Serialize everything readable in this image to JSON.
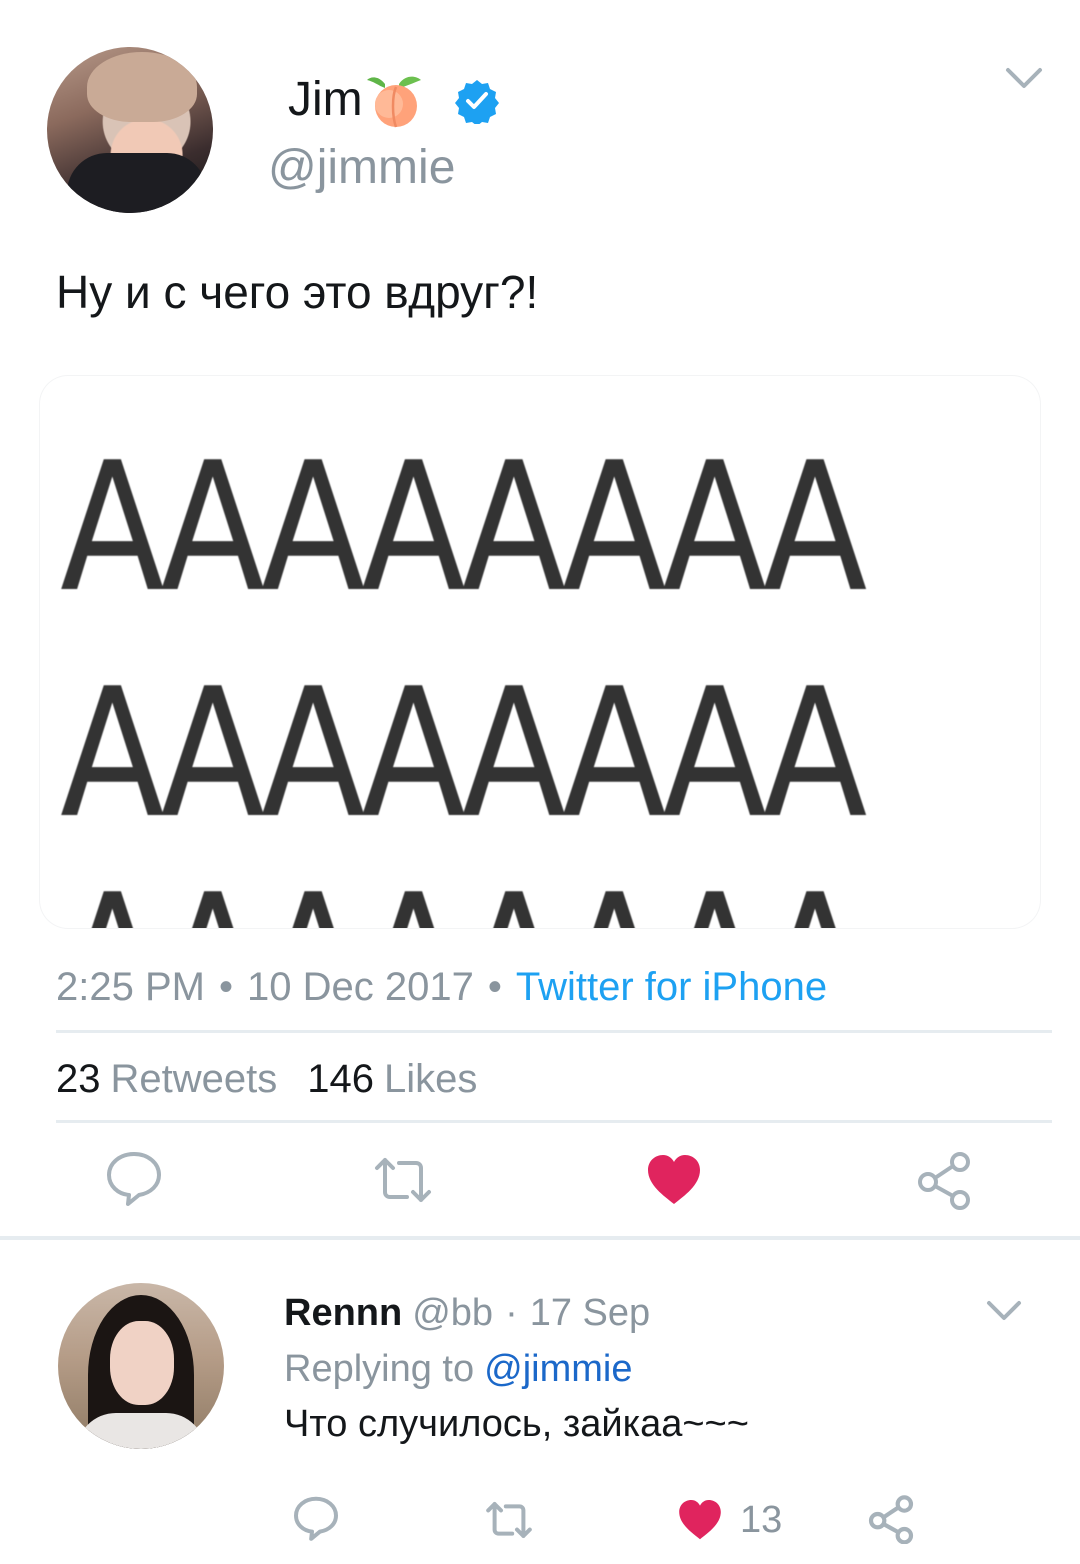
{
  "tweet": {
    "display_name": "Jim",
    "handle": "@jimmie",
    "text": "Ну и с чего это вдруг?!",
    "media_text": {
      "row1": "AAAAAAAA",
      "row2": "AAAAAAAA",
      "row3": "AAAAAAAA"
    },
    "time": "2:25 PM",
    "date": "10 Dec 2017",
    "source": "Twitter for iPhone",
    "separator": "•",
    "retweets_count": "23",
    "retweets_label": "Retweets",
    "likes_count": "146",
    "likes_label": "Likes",
    "liked": true
  },
  "reply": {
    "name": "Rennn",
    "handle": "@bb",
    "separator": "·",
    "date": "17 Sep",
    "replying_label": "Replying to",
    "replying_to": "@jimmie",
    "text": "Что случилось, зайкаа~~~",
    "likes_count": "13",
    "liked": true
  },
  "colors": {
    "accent": "#1da1f2",
    "like": "#e0245e",
    "muted": "#8a959e",
    "text": "#14171a"
  },
  "icons": [
    "peach-emoji",
    "verified-badge-icon",
    "chevron-down-icon",
    "reply-icon",
    "retweet-icon",
    "heart-icon",
    "share-icon"
  ]
}
